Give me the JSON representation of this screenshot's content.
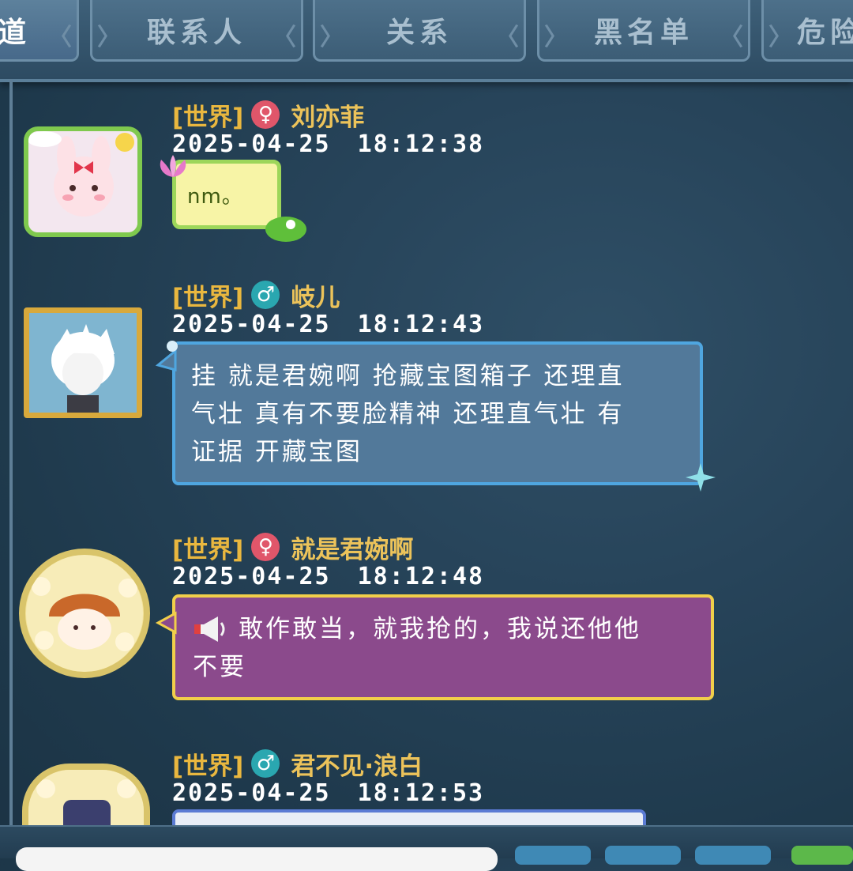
{
  "tabs": [
    {
      "label": "频道",
      "shown": "频道",
      "active": true
    },
    {
      "label": "联系人",
      "active": false
    },
    {
      "label": "关系",
      "active": false
    },
    {
      "label": "黑名单",
      "active": false
    },
    {
      "label": "危险",
      "shown": "危险",
      "active": false
    }
  ],
  "messages": [
    {
      "channel": "[世界]",
      "gender": "♀",
      "name": "刘亦菲",
      "date": "2025-04-25",
      "time": "18:12:38",
      "text": "nm。",
      "bubble": "green"
    },
    {
      "channel": "[世界]",
      "gender": "♂",
      "name": "岐儿",
      "date": "2025-04-25",
      "time": "18:12:43",
      "lines": [
        "挂 就是君婉啊 抢藏宝图箱子 还理直",
        "气壮 真有不要脸精神 还理直气壮 有",
        "证据 开藏宝图"
      ],
      "bubble": "blue"
    },
    {
      "channel": "[世界]",
      "gender": "♀",
      "name": "就是君婉啊",
      "date": "2025-04-25",
      "time": "18:12:48",
      "lines": [
        "敢作敢当，就我抢的，我说还他他",
        "不要"
      ],
      "icon": "megaphone-icon",
      "bubble": "purple"
    },
    {
      "channel": "[世界]",
      "gender": "♂",
      "name": "君不见·浪白",
      "date": "2025-04-25",
      "time": "18:12:53",
      "bubble": "white"
    }
  ],
  "colors": {
    "channel": "#e9b73f",
    "name": "#ecc35a",
    "female": "#e0566a",
    "male": "#2aa7b0"
  }
}
